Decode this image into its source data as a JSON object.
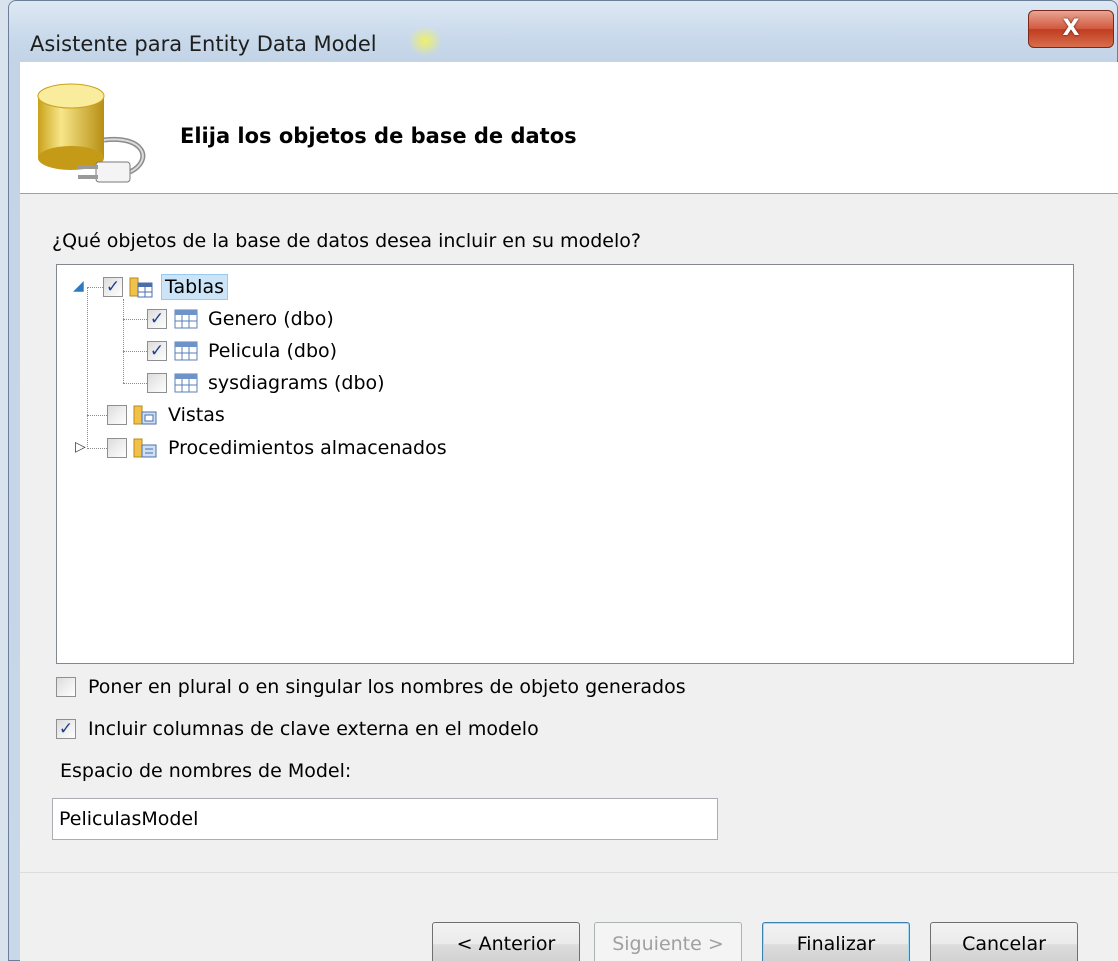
{
  "window": {
    "title": "Asistente para Entity Data Model",
    "close_glyph": "X"
  },
  "header": {
    "title": "Elija los objetos de base de datos",
    "icon": "database-connection-icon"
  },
  "question": "¿Qué objetos de la base de datos desea incluir en su modelo?",
  "tree": {
    "tables": {
      "label": "Tablas",
      "checked": true,
      "expanded": true
    },
    "table_items": [
      {
        "label": "Genero (dbo)",
        "checked": true
      },
      {
        "label": "Pelicula (dbo)",
        "checked": true
      },
      {
        "label": "sysdiagrams (dbo)",
        "checked": false
      }
    ],
    "views": {
      "label": "Vistas",
      "checked": false
    },
    "procedures": {
      "label": "Procedimientos almacenados",
      "checked": false,
      "expanded": false
    }
  },
  "options": {
    "pluralize": {
      "label": "Poner en plural o en singular los nombres de objeto generados",
      "checked": false
    },
    "foreign_keys": {
      "label": "Incluir columnas de clave externa en el modelo",
      "checked": true
    }
  },
  "namespace": {
    "label": "Espacio de nombres de Model:",
    "value": "PeliculasModel"
  },
  "buttons": {
    "back": "< Anterior",
    "next": "Siguiente >",
    "finish": "Finalizar",
    "cancel": "Cancelar"
  },
  "colors": {
    "check": "#21408a",
    "selection": "#cce4f7",
    "close_button": "#c84a2d"
  }
}
